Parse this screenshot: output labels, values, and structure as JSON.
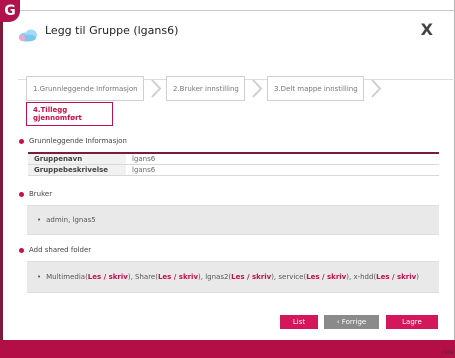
{
  "badge": "G",
  "dialog": {
    "title": "Legg til Gruppe  (lgans6)",
    "close_symbol": "X"
  },
  "steps": [
    {
      "label": "1.Grunnleggende Informasjon"
    },
    {
      "label": "2.Bruker innstilling"
    },
    {
      "label": "3.Delt mappe innstilling"
    },
    {
      "label": "4.Tillegg gjennomført"
    }
  ],
  "basic_info": {
    "heading": "Grunnleggende Informasjon",
    "rows": [
      {
        "label": "Gruppenavn",
        "value": "lgans6"
      },
      {
        "label": "Gruppebeskrivelse",
        "value": "lgans6"
      }
    ]
  },
  "users": {
    "heading": "Bruker",
    "text": "admin, lgnas5"
  },
  "shared": {
    "heading": "Add shared folder",
    "items": [
      {
        "name": "Multimedia",
        "perm": "Les / skriv"
      },
      {
        "name": "Share",
        "perm": "Les / skriv"
      },
      {
        "name": "lgnas2",
        "perm": "Les / skriv"
      },
      {
        "name": "service",
        "perm": "Les / skriv"
      },
      {
        "name": "x-hdd",
        "perm": "Les / skriv"
      }
    ]
  },
  "buttons": {
    "list": "List",
    "previous": "‹ Forrige",
    "save": "Lagre"
  },
  "footer": {
    "close_text": "clos"
  },
  "colors": {
    "accent": "#c4104c",
    "bottom_bar": "#b30e45"
  }
}
